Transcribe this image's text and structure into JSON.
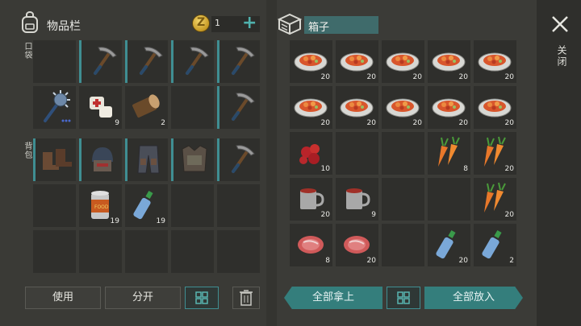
{
  "inventory": {
    "title": "物品栏",
    "coins": "1",
    "add_label": "+",
    "pocket_label": "口袋",
    "backpack_label": "背包",
    "pocket_cells": [
      {
        "icon": "",
        "count": ""
      },
      {
        "icon": "pickaxe-icon",
        "count": ""
      },
      {
        "icon": "pickaxe-icon",
        "count": ""
      },
      {
        "icon": "pickaxe-icon",
        "count": ""
      },
      {
        "icon": "pickaxe-icon",
        "count": ""
      },
      {
        "icon": "spiked-club-icon",
        "count": ""
      },
      {
        "icon": "bandage-icon",
        "count": "9"
      },
      {
        "icon": "log-icon",
        "count": "2"
      },
      {
        "icon": "",
        "count": ""
      },
      {
        "icon": "pickaxe-icon",
        "count": ""
      }
    ],
    "backpack_cells": [
      {
        "icon": "boots-icon",
        "count": ""
      },
      {
        "icon": "helmet-icon",
        "count": ""
      },
      {
        "icon": "pants-icon",
        "count": ""
      },
      {
        "icon": "armor-vest-icon",
        "count": ""
      },
      {
        "icon": "pickaxe-icon",
        "count": ""
      },
      {
        "icon": "",
        "count": ""
      },
      {
        "icon": "canned-food-icon",
        "count": "19"
      },
      {
        "icon": "water-bottle-icon",
        "count": "19"
      },
      {
        "icon": "",
        "count": ""
      },
      {
        "icon": "",
        "count": ""
      },
      {
        "icon": "",
        "count": ""
      },
      {
        "icon": "",
        "count": ""
      },
      {
        "icon": "",
        "count": ""
      },
      {
        "icon": "",
        "count": ""
      },
      {
        "icon": "",
        "count": ""
      }
    ],
    "use_label": "使用",
    "split_label": "分开"
  },
  "box": {
    "title": "箱子",
    "cells": [
      {
        "icon": "stew-plate-icon",
        "count": "20"
      },
      {
        "icon": "stew-plate-icon",
        "count": "20"
      },
      {
        "icon": "stew-plate-icon",
        "count": "20"
      },
      {
        "icon": "stew-plate-icon",
        "count": "20"
      },
      {
        "icon": "stew-plate-icon",
        "count": "20"
      },
      {
        "icon": "stew-plate-icon",
        "count": "20"
      },
      {
        "icon": "stew-plate-icon",
        "count": "20"
      },
      {
        "icon": "stew-plate-icon",
        "count": "20"
      },
      {
        "icon": "stew-plate-icon",
        "count": "20"
      },
      {
        "icon": "stew-plate-icon",
        "count": "20"
      },
      {
        "icon": "berries-icon",
        "count": "10"
      },
      {
        "icon": "",
        "count": ""
      },
      {
        "icon": "",
        "count": ""
      },
      {
        "icon": "carrots-icon",
        "count": "8"
      },
      {
        "icon": "carrots-icon",
        "count": "20"
      },
      {
        "icon": "mug-icon",
        "count": "20"
      },
      {
        "icon": "mug-icon",
        "count": "9"
      },
      {
        "icon": "",
        "count": ""
      },
      {
        "icon": "",
        "count": ""
      },
      {
        "icon": "carrots-icon",
        "count": "20"
      },
      {
        "icon": "steak-icon",
        "count": "8"
      },
      {
        "icon": "steak-icon",
        "count": "20"
      },
      {
        "icon": "",
        "count": ""
      },
      {
        "icon": "water-bottle-icon",
        "count": "20"
      },
      {
        "icon": "water-bottle-icon",
        "count": "2"
      }
    ],
    "take_all_label": "全部拿上",
    "put_all_label": "全部放入"
  },
  "close_label": "关闭"
}
